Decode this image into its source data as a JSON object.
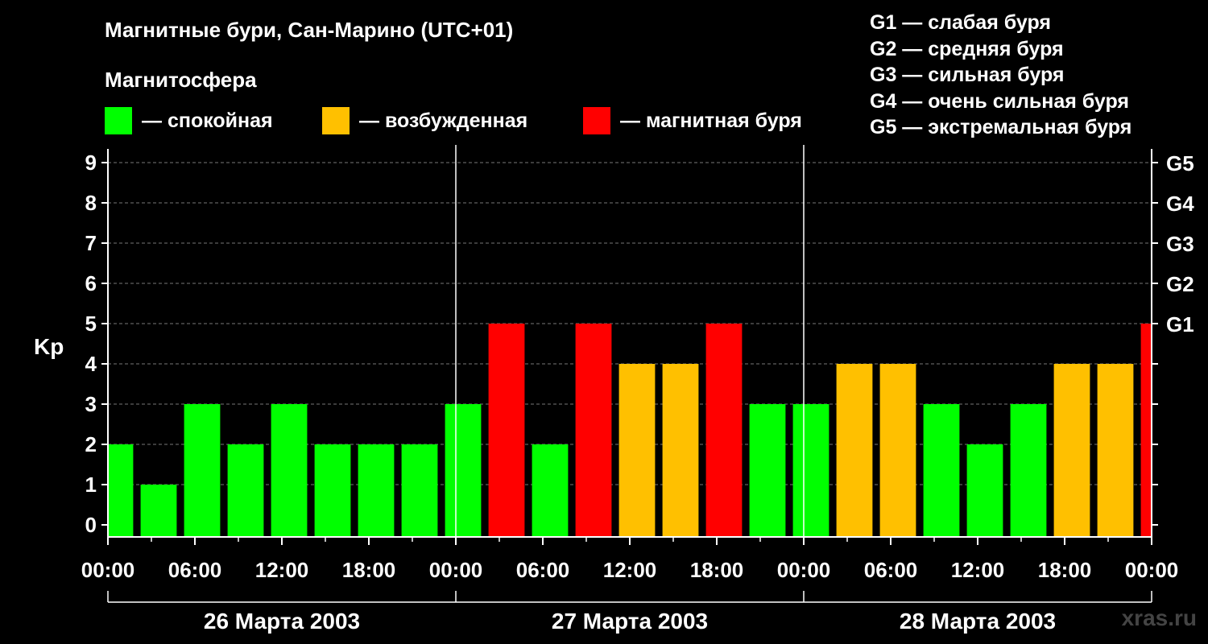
{
  "title": "Магнитные бури, Сан-Марино (UTC+01)",
  "subtitle": "Магнитосфера",
  "legend": [
    {
      "label": "— спокойная",
      "color": "#00ff00"
    },
    {
      "label": "— возбужденная",
      "color": "#ffc000"
    },
    {
      "label": "— магнитная буря",
      "color": "#ff0000"
    }
  ],
  "g_legend": [
    "G1 — слабая буря",
    "G2 — средняя буря",
    "G3 — сильная буря",
    "G4 — очень сильная буря",
    "G5 — экстремальная буря"
  ],
  "watermark": "xras.ru",
  "chart_data": {
    "type": "bar",
    "ylabel": "Kp",
    "ylim": [
      0,
      9
    ],
    "yticks": [
      "0",
      "1",
      "2",
      "3",
      "4",
      "5",
      "6",
      "7",
      "8",
      "9"
    ],
    "right_ticks": [
      {
        "value": 5,
        "label": "G1"
      },
      {
        "value": 6,
        "label": "G2"
      },
      {
        "value": 7,
        "label": "G3"
      },
      {
        "value": 8,
        "label": "G4"
      },
      {
        "value": 9,
        "label": "G5"
      }
    ],
    "x_tick_labels": [
      "00:00",
      "06:00",
      "12:00",
      "18:00",
      "00:00",
      "06:00",
      "12:00",
      "18:00",
      "00:00",
      "06:00",
      "12:00",
      "18:00",
      "00:00"
    ],
    "days": [
      "26 Марта 2003",
      "27 Марта 2003",
      "28 Марта 2003"
    ],
    "x_start_hour": 0.5,
    "bar_interval_hours": 3,
    "values": [
      2,
      1,
      3,
      2,
      3,
      2,
      2,
      2,
      3,
      5,
      2,
      5,
      4,
      4,
      5,
      3,
      3,
      4,
      4,
      3,
      2,
      3,
      4,
      4,
      5
    ],
    "levels": [
      "quiet",
      "quiet",
      "quiet",
      "quiet",
      "quiet",
      "quiet",
      "quiet",
      "quiet",
      "quiet",
      "storm",
      "quiet",
      "storm",
      "active",
      "active",
      "storm",
      "quiet",
      "quiet",
      "active",
      "active",
      "quiet",
      "quiet",
      "quiet",
      "active",
      "active",
      "storm"
    ],
    "level_colors": {
      "quiet": "#00ff00",
      "active": "#ffc000",
      "storm": "#ff0000"
    },
    "grid": true
  }
}
